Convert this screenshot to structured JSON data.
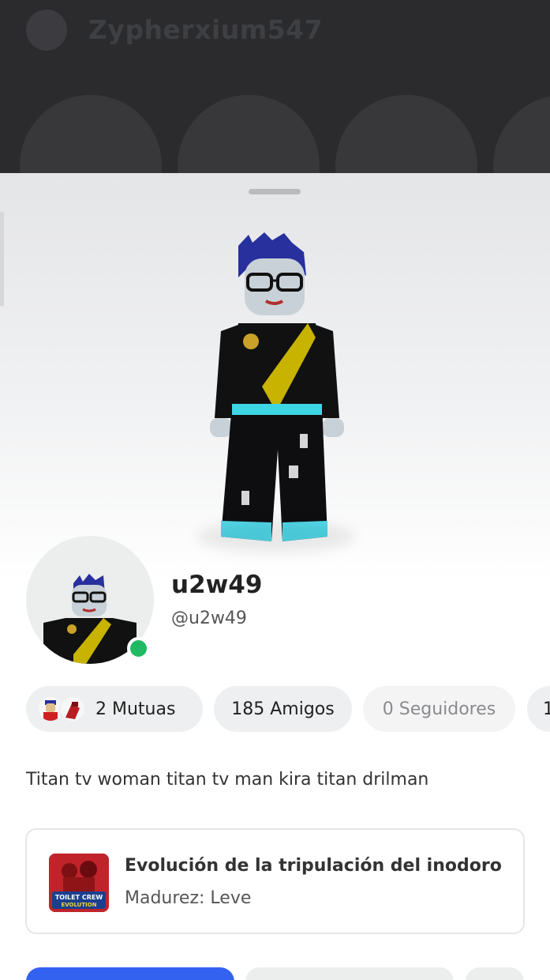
{
  "background": {
    "title": "Zypherxium547"
  },
  "profile": {
    "display_name": "u2w49",
    "username": "@u2w49",
    "online": true,
    "bio": "Titan tv woman titan tv man kira titan drilman"
  },
  "stats": {
    "mutuals_label": "2 Mutuas",
    "friends_label": "185 Amigos",
    "followers_label": "0 Seguidores",
    "following_label": "1"
  },
  "game": {
    "title": "Evolución de la tripulación del inodoro",
    "maturity": "Madurez: Leve",
    "thumb_text_1": "TOILET CREW",
    "thumb_text_2": "EVOLUTION"
  },
  "colors": {
    "online": "#22b964",
    "primary_button": "#3361f0"
  }
}
